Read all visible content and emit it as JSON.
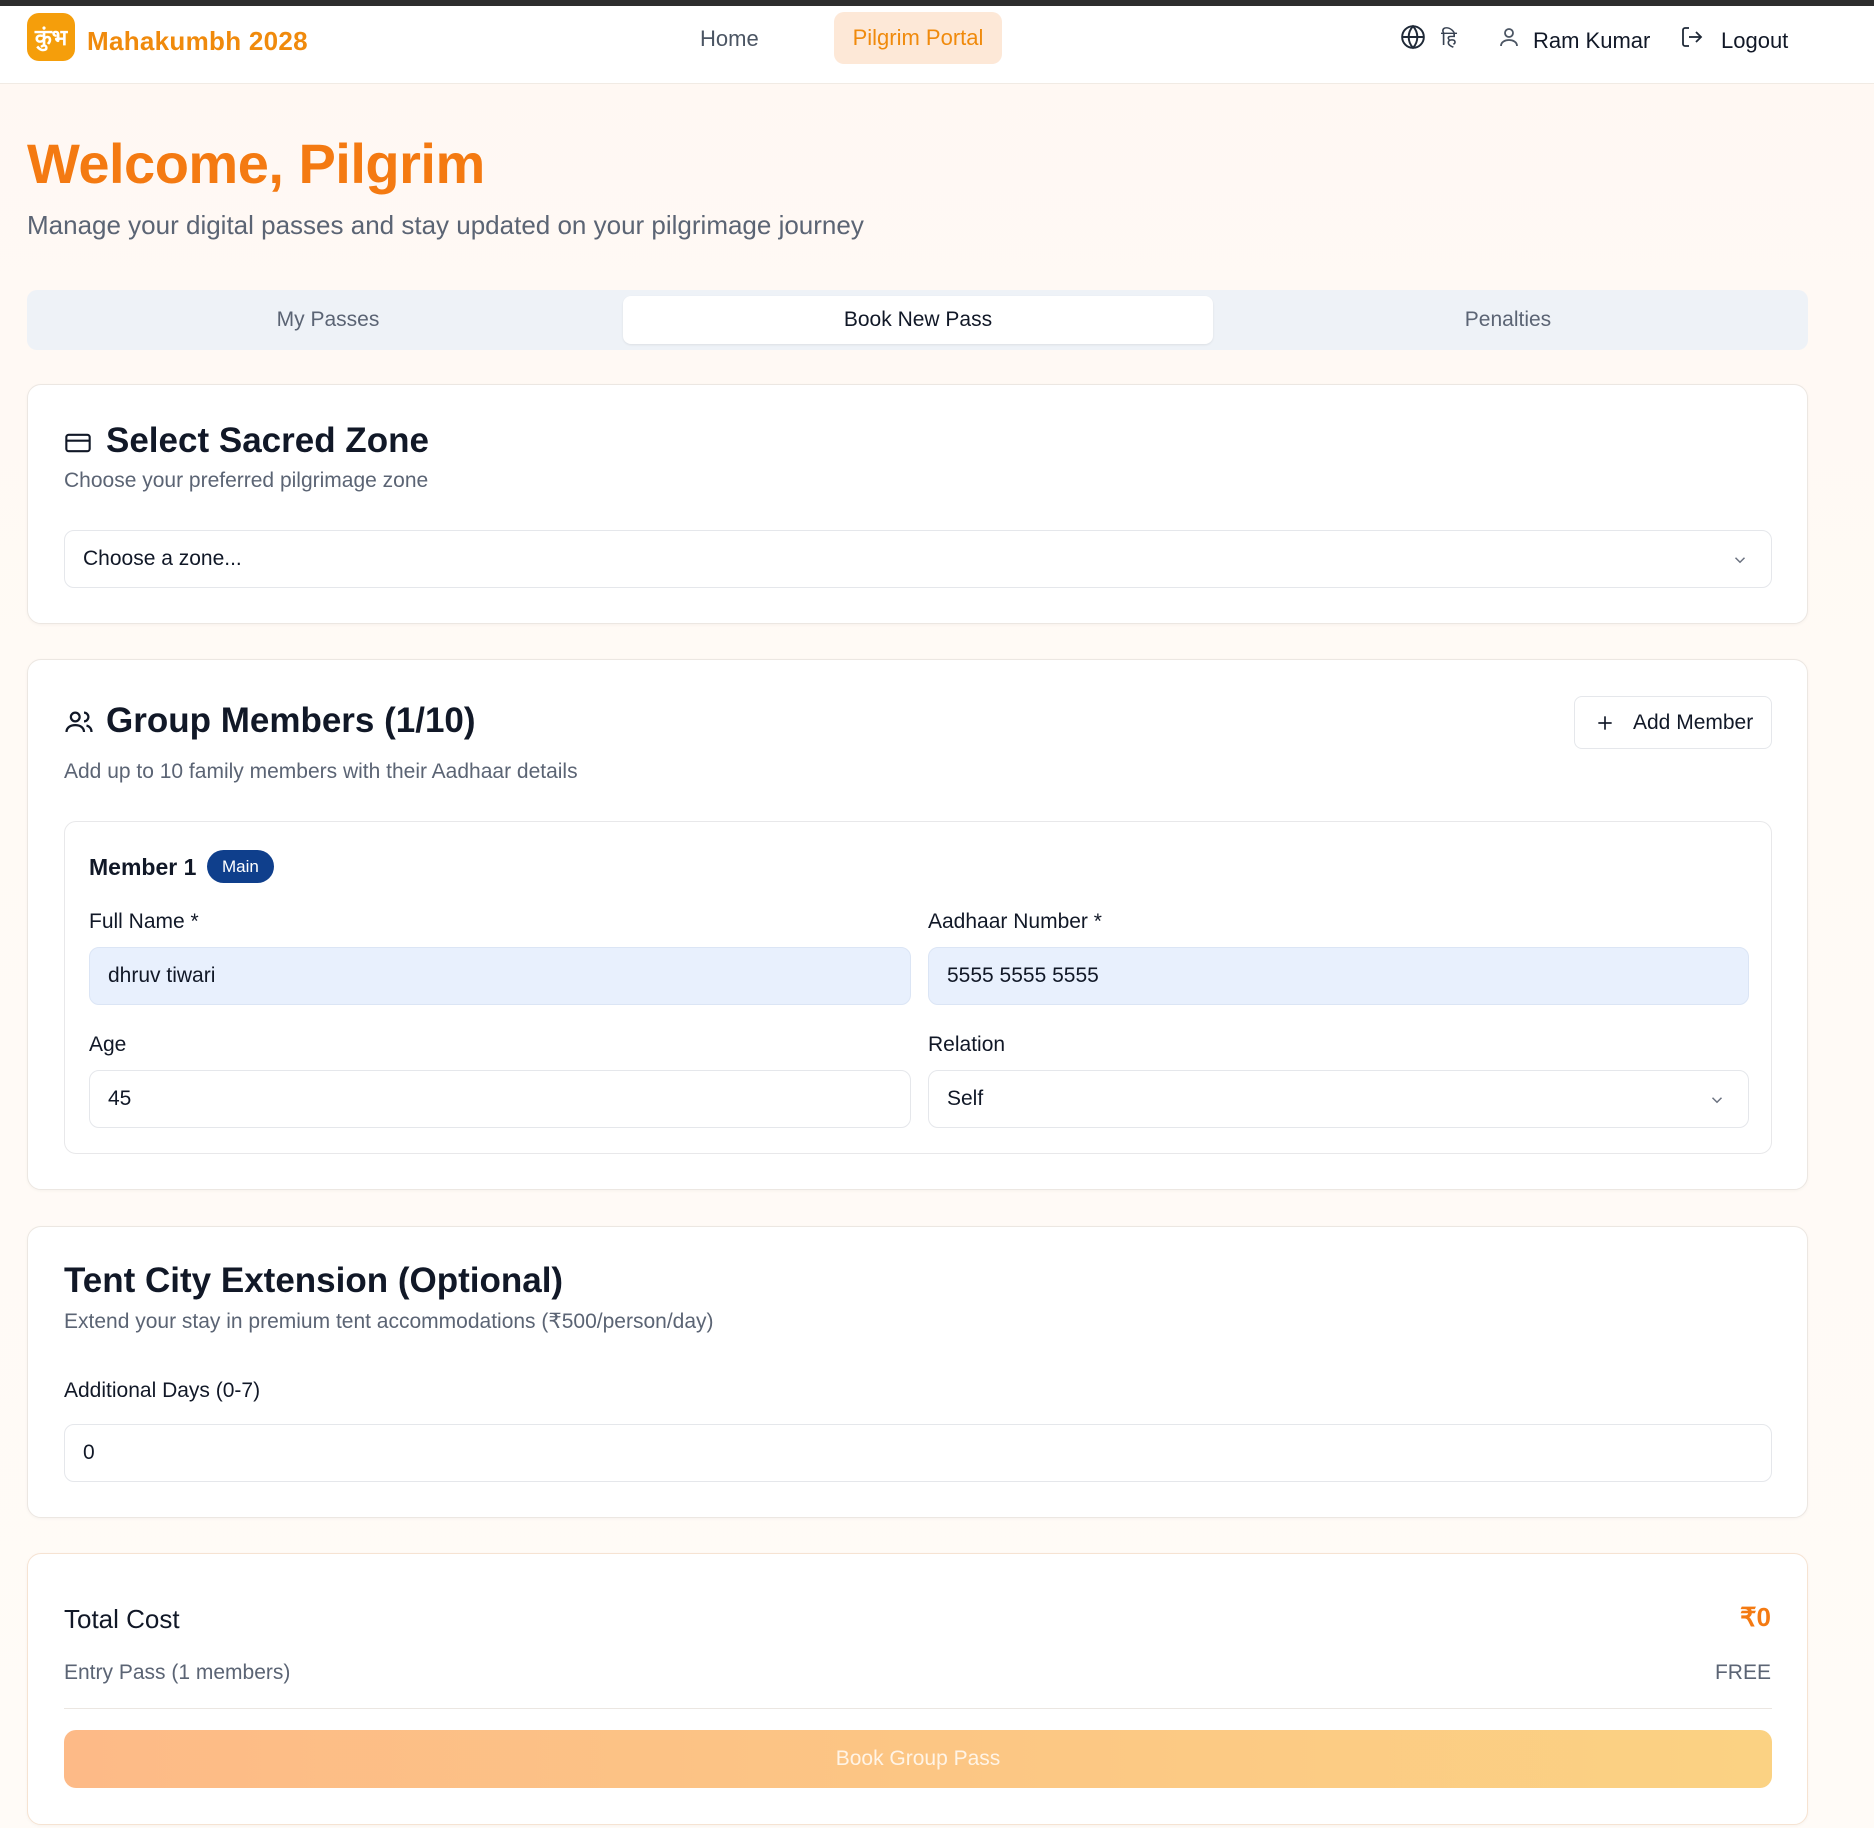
{
  "header": {
    "logo_glyph": "कुंभ",
    "brand": "Mahakumbh 2028",
    "nav_home": "Home",
    "nav_portal": "Pilgrim Portal",
    "lang_label": "हि",
    "user_name": "Ram Kumar",
    "logout": "Logout",
    "icons": [
      "globe-icon",
      "user-icon",
      "logout-icon"
    ]
  },
  "hero": {
    "title": "Welcome, Pilgrim",
    "subtitle": "Manage your digital passes and stay updated on your pilgrimage journey"
  },
  "tabs": [
    {
      "label": "My Passes",
      "active": false
    },
    {
      "label": "Book New Pass",
      "active": true
    },
    {
      "label": "Penalties",
      "active": false
    }
  ],
  "zone": {
    "title": "Select Sacred Zone",
    "desc": "Choose your preferred pilgrimage zone",
    "select_value": "Choose a zone..."
  },
  "group": {
    "title": "Group Members (1/10)",
    "desc": "Add up to 10 family members with their Aadhaar details",
    "add_button": "Add Member",
    "member": {
      "title": "Member 1",
      "badge": "Main",
      "full_name_label": "Full Name *",
      "full_name": "dhruv tiwari",
      "aadhaar_label": "Aadhaar Number *",
      "aadhaar": "5555 5555 5555",
      "age_label": "Age",
      "age": "45",
      "relation_label": "Relation",
      "relation": "Self"
    }
  },
  "tent": {
    "title": "Tent City Extension (Optional)",
    "desc": "Extend your stay in premium tent accommodations (₹500/person/day)",
    "days_label": "Additional Days (0-7)",
    "days_value": "0"
  },
  "cost": {
    "title": "Total Cost",
    "amount": "₹0",
    "entry_label": "Entry Pass (1 members)",
    "entry_value": "FREE",
    "book_button": "Book Group Pass"
  },
  "colors": {
    "accent": "#f47a12",
    "badge": "#0f3f8c",
    "filled_input": "#e8f0fd"
  }
}
